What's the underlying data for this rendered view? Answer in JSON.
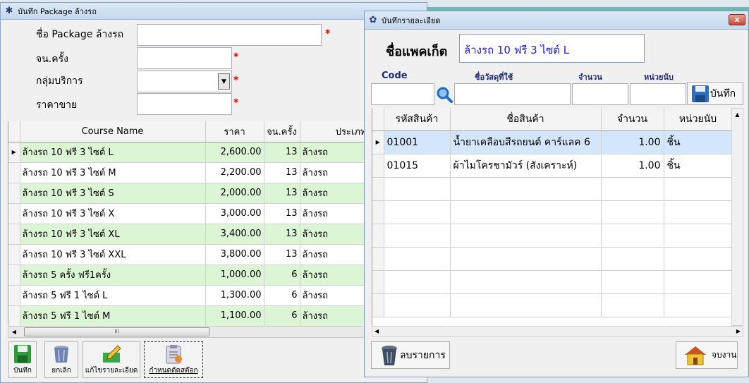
{
  "pkg_window": {
    "title": "บันทึก Package ล้างรถ",
    "form": {
      "name_label": "ชื่อ Package ล้างรถ",
      "count_label": "จน.ครั้ง",
      "group_label": "กลุ่มบริการ",
      "price_label": "ราคาขาย",
      "required_mark": "*"
    },
    "columns": [
      "Course Name",
      "ราคา",
      "จน.ครั้ง",
      "ประเภท"
    ],
    "rows": [
      {
        "name": "ล้างรถ 10 ฟรี 3 ไซต์ L",
        "price": "2,600.00",
        "count": "13",
        "type": "ล้างรถ"
      },
      {
        "name": "ล้างรถ 10 ฟรี 3 ไซต์ M",
        "price": "2,200.00",
        "count": "13",
        "type": "ล้างรถ"
      },
      {
        "name": "ล้างรถ 10 ฟรี 3 ไซต์ S",
        "price": "2,000.00",
        "count": "13",
        "type": "ล้างรถ"
      },
      {
        "name": "ล้างรถ 10 ฟรี 3 ไซต์ X",
        "price": "3,000.00",
        "count": "13",
        "type": "ล้างรถ"
      },
      {
        "name": "ล้างรถ 10 ฟรี 3 ไซต์ XL",
        "price": "3,400.00",
        "count": "13",
        "type": "ล้างรถ"
      },
      {
        "name": "ล้างรถ 10 ฟรี 3 ไซต์ XXL",
        "price": "3,800.00",
        "count": "13",
        "type": "ล้างรถ"
      },
      {
        "name": "ล้างรถ 5 ครั้ง ฟรี1ครั้ง",
        "price": "1,000.00",
        "count": "6",
        "type": "ล้างรถ"
      },
      {
        "name": "ล้างรถ 5 ฟรี 1 ไซต์ L",
        "price": "1,300.00",
        "count": "6",
        "type": "ล้างรถ"
      },
      {
        "name": "ล้างรถ 5 ฟรี 1 ไซต์ M",
        "price": "1,100.00",
        "count": "6",
        "type": "ล้างรถ"
      }
    ],
    "scroll_grip": "III",
    "buttons": {
      "save": "บันทึก",
      "cancel": "ยกเลิก",
      "edit_detail": "แก้ไขรายละเอียด",
      "set_stock": "กำหนดตัดสต๊อก"
    }
  },
  "detail_window": {
    "title": "บันทึกรายละเอียด",
    "close": "x",
    "package_label": "ชื่อแพคเก็ต",
    "package_value": "ล้างรถ 10 ฟรี 3 ไซต์ L",
    "entry_labels": {
      "code": "Code",
      "material": "ชื่อวัสดุที่ใช้",
      "qty": "จำนวน",
      "unit": "หน่วยนับ"
    },
    "save_label": "บันทึก",
    "columns": [
      "รหัสสินค้า",
      "ชื่อสินค้า",
      "จำนวน",
      "หน่วยนับ"
    ],
    "rows": [
      {
        "code": "01001",
        "name": "น้ำยาเคลือบสีรถยนต์ คาร์แลค 6",
        "qty": "1.00",
        "unit": "ชิ้น"
      },
      {
        "code": "01015",
        "name": "ผ้าไมโครชามัวร์ (สังเคราะห์)",
        "qty": "1.00",
        "unit": "ชิ้น"
      }
    ],
    "delete_label": "ลบรายการ",
    "close_label": "จบงาน"
  },
  "icons": [
    "app-icon",
    "floppy-save-icon",
    "trash-can-icon",
    "edit-pencil-icon",
    "stock-clipboard-icon",
    "search-magnifier-icon",
    "trash-delete-icon",
    "house-exit-icon"
  ]
}
